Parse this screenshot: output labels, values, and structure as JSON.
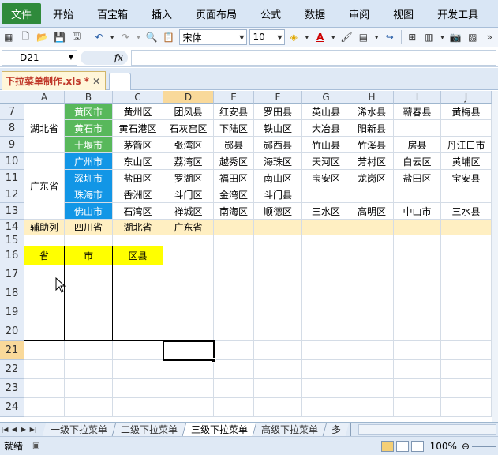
{
  "menu": {
    "file": "文件",
    "items": [
      "开始",
      "百宝箱",
      "插入",
      "页面布局",
      "公式",
      "数据",
      "审阅",
      "视图",
      "开发工具"
    ]
  },
  "toolbar": {
    "font_name": "宋体",
    "font_size": "10"
  },
  "formula_bar": {
    "name_box": "D21",
    "fx_label": "fx",
    "formula": ""
  },
  "workbook_tab": {
    "title": "下拉菜单制作.xls *",
    "close": "✕"
  },
  "columns": [
    "A",
    "B",
    "C",
    "D",
    "E",
    "F",
    "G",
    "H",
    "I",
    "J"
  ],
  "selected_column": "D",
  "rows": [
    "7",
    "8",
    "9",
    "10",
    "11",
    "12",
    "13",
    "14",
    "15",
    "16",
    "17",
    "18",
    "19",
    "20",
    "21",
    "22",
    "23",
    "24"
  ],
  "selected_row": "21",
  "cells": {
    "A7": "湖北省",
    "A10": "广东省",
    "B7": "黄冈市",
    "C7": "黄州区",
    "D7": "团风县",
    "E7": "红安县",
    "F7": "罗田县",
    "G7": "英山县",
    "H7": "浠水县",
    "I7": "蕲春县",
    "J7": "黄梅县",
    "B8": "黄石市",
    "C8": "黄石港区",
    "D8": "石灰窑区",
    "E8": "下陆区",
    "F8": "铁山区",
    "G8": "大冶县",
    "H8": "阳新县",
    "B9": "十堰市",
    "C9": "茅箭区",
    "D9": "张湾区",
    "E9": "郧县",
    "F9": "郧西县",
    "G9": "竹山县",
    "H9": "竹溪县",
    "I9": "房县",
    "J9": "丹江口市",
    "B10": "广州市",
    "C10": "东山区",
    "D10": "荔湾区",
    "E10": "越秀区",
    "F10": "海珠区",
    "G10": "天河区",
    "H10": "芳村区",
    "I10": "白云区",
    "J10": "黄埔区",
    "B11": "深圳市",
    "C11": "盐田区",
    "D11": "罗湖区",
    "E11": "福田区",
    "F11": "南山区",
    "G11": "宝安区",
    "H11": "龙岗区",
    "I11": "盐田区",
    "J11": "宝安县",
    "B12": "珠海市",
    "C12": "香洲区",
    "D12": "斗门区",
    "E12": "金湾区",
    "F12": "斗门县",
    "B13": "佛山市",
    "C13": "石湾区",
    "D13": "禅城区",
    "E13": "南海区",
    "F13": "顺德区",
    "G13": "三水区",
    "H13": "高明区",
    "I13": "中山市",
    "J13": "三水县",
    "A14": "辅助列",
    "B14": "四川省",
    "C14": "湖北省",
    "D14": "广东省",
    "A16": "省",
    "B16": "市",
    "C16": "区县"
  },
  "sheet_tabs": [
    "一级下拉菜单",
    "二级下拉菜单",
    "三级下拉菜单",
    "高级下拉菜单",
    "多"
  ],
  "active_sheet": "三级下拉菜单",
  "status": {
    "ready": "就绪",
    "zoom": "100%"
  },
  "colors": {
    "green": "#58b85b",
    "blue": "#1296e6",
    "yellow": "#ffff00",
    "cream": "#ffefc2",
    "file_tab": "#2f8a3b"
  }
}
